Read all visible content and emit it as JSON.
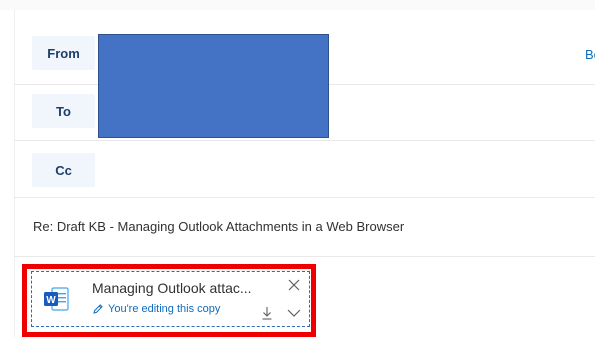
{
  "header": {
    "from_label": "From",
    "to_label": "To",
    "cc_label": "Cc",
    "bcc_label": "Bcc"
  },
  "subject": {
    "value": "Re: Draft KB - Managing Outlook Attachments in a Web Browser"
  },
  "attachment": {
    "name": "Managing Outlook attac...",
    "status": "You're editing this copy",
    "icon": "word-file-icon"
  },
  "colors": {
    "accent": "#0f6cbd",
    "field_button_bg": "#f0f6fc",
    "redaction": "#4472c4",
    "highlight": "#ee0000"
  }
}
